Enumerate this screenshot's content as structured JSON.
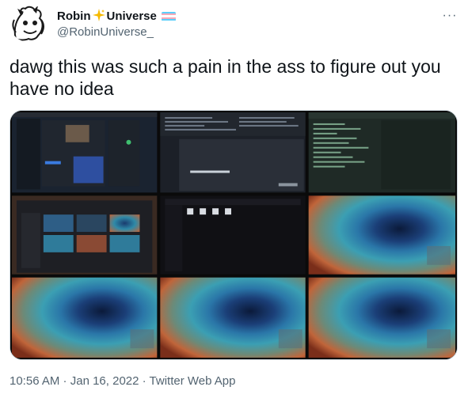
{
  "author": {
    "name_part1": "Robin",
    "name_part2": "Universe",
    "sparkle_icon": "sparkle-icon",
    "flag_icon": "transgender-flag-icon",
    "flag_colors": [
      "#5bcefa",
      "#f5a9b8",
      "#ffffff",
      "#f5a9b8",
      "#5bcefa"
    ],
    "handle": "@RobinUniverse_"
  },
  "more_icon": "more-horizontal-icon",
  "more_label": "···",
  "tweet": {
    "text": "dawg this was such a pain in the ass to figure out you have no idea"
  },
  "media": {
    "tiles": [
      {
        "kind": "desktop-chat"
      },
      {
        "kind": "desktop-code-dialog",
        "dialog_title": "Welcome to Ubuntu"
      },
      {
        "kind": "desktop-code"
      },
      {
        "kind": "desktop-windows-grid"
      },
      {
        "kind": "desktop-file-manager"
      },
      {
        "kind": "wallpaper-eye"
      },
      {
        "kind": "wallpaper-eye"
      },
      {
        "kind": "wallpaper-eye"
      },
      {
        "kind": "wallpaper-eye"
      }
    ]
  },
  "meta": {
    "time": "10:56 AM",
    "sep1": " · ",
    "date": "Jan 16, 2022",
    "sep2": " · ",
    "source": "Twitter Web App"
  }
}
